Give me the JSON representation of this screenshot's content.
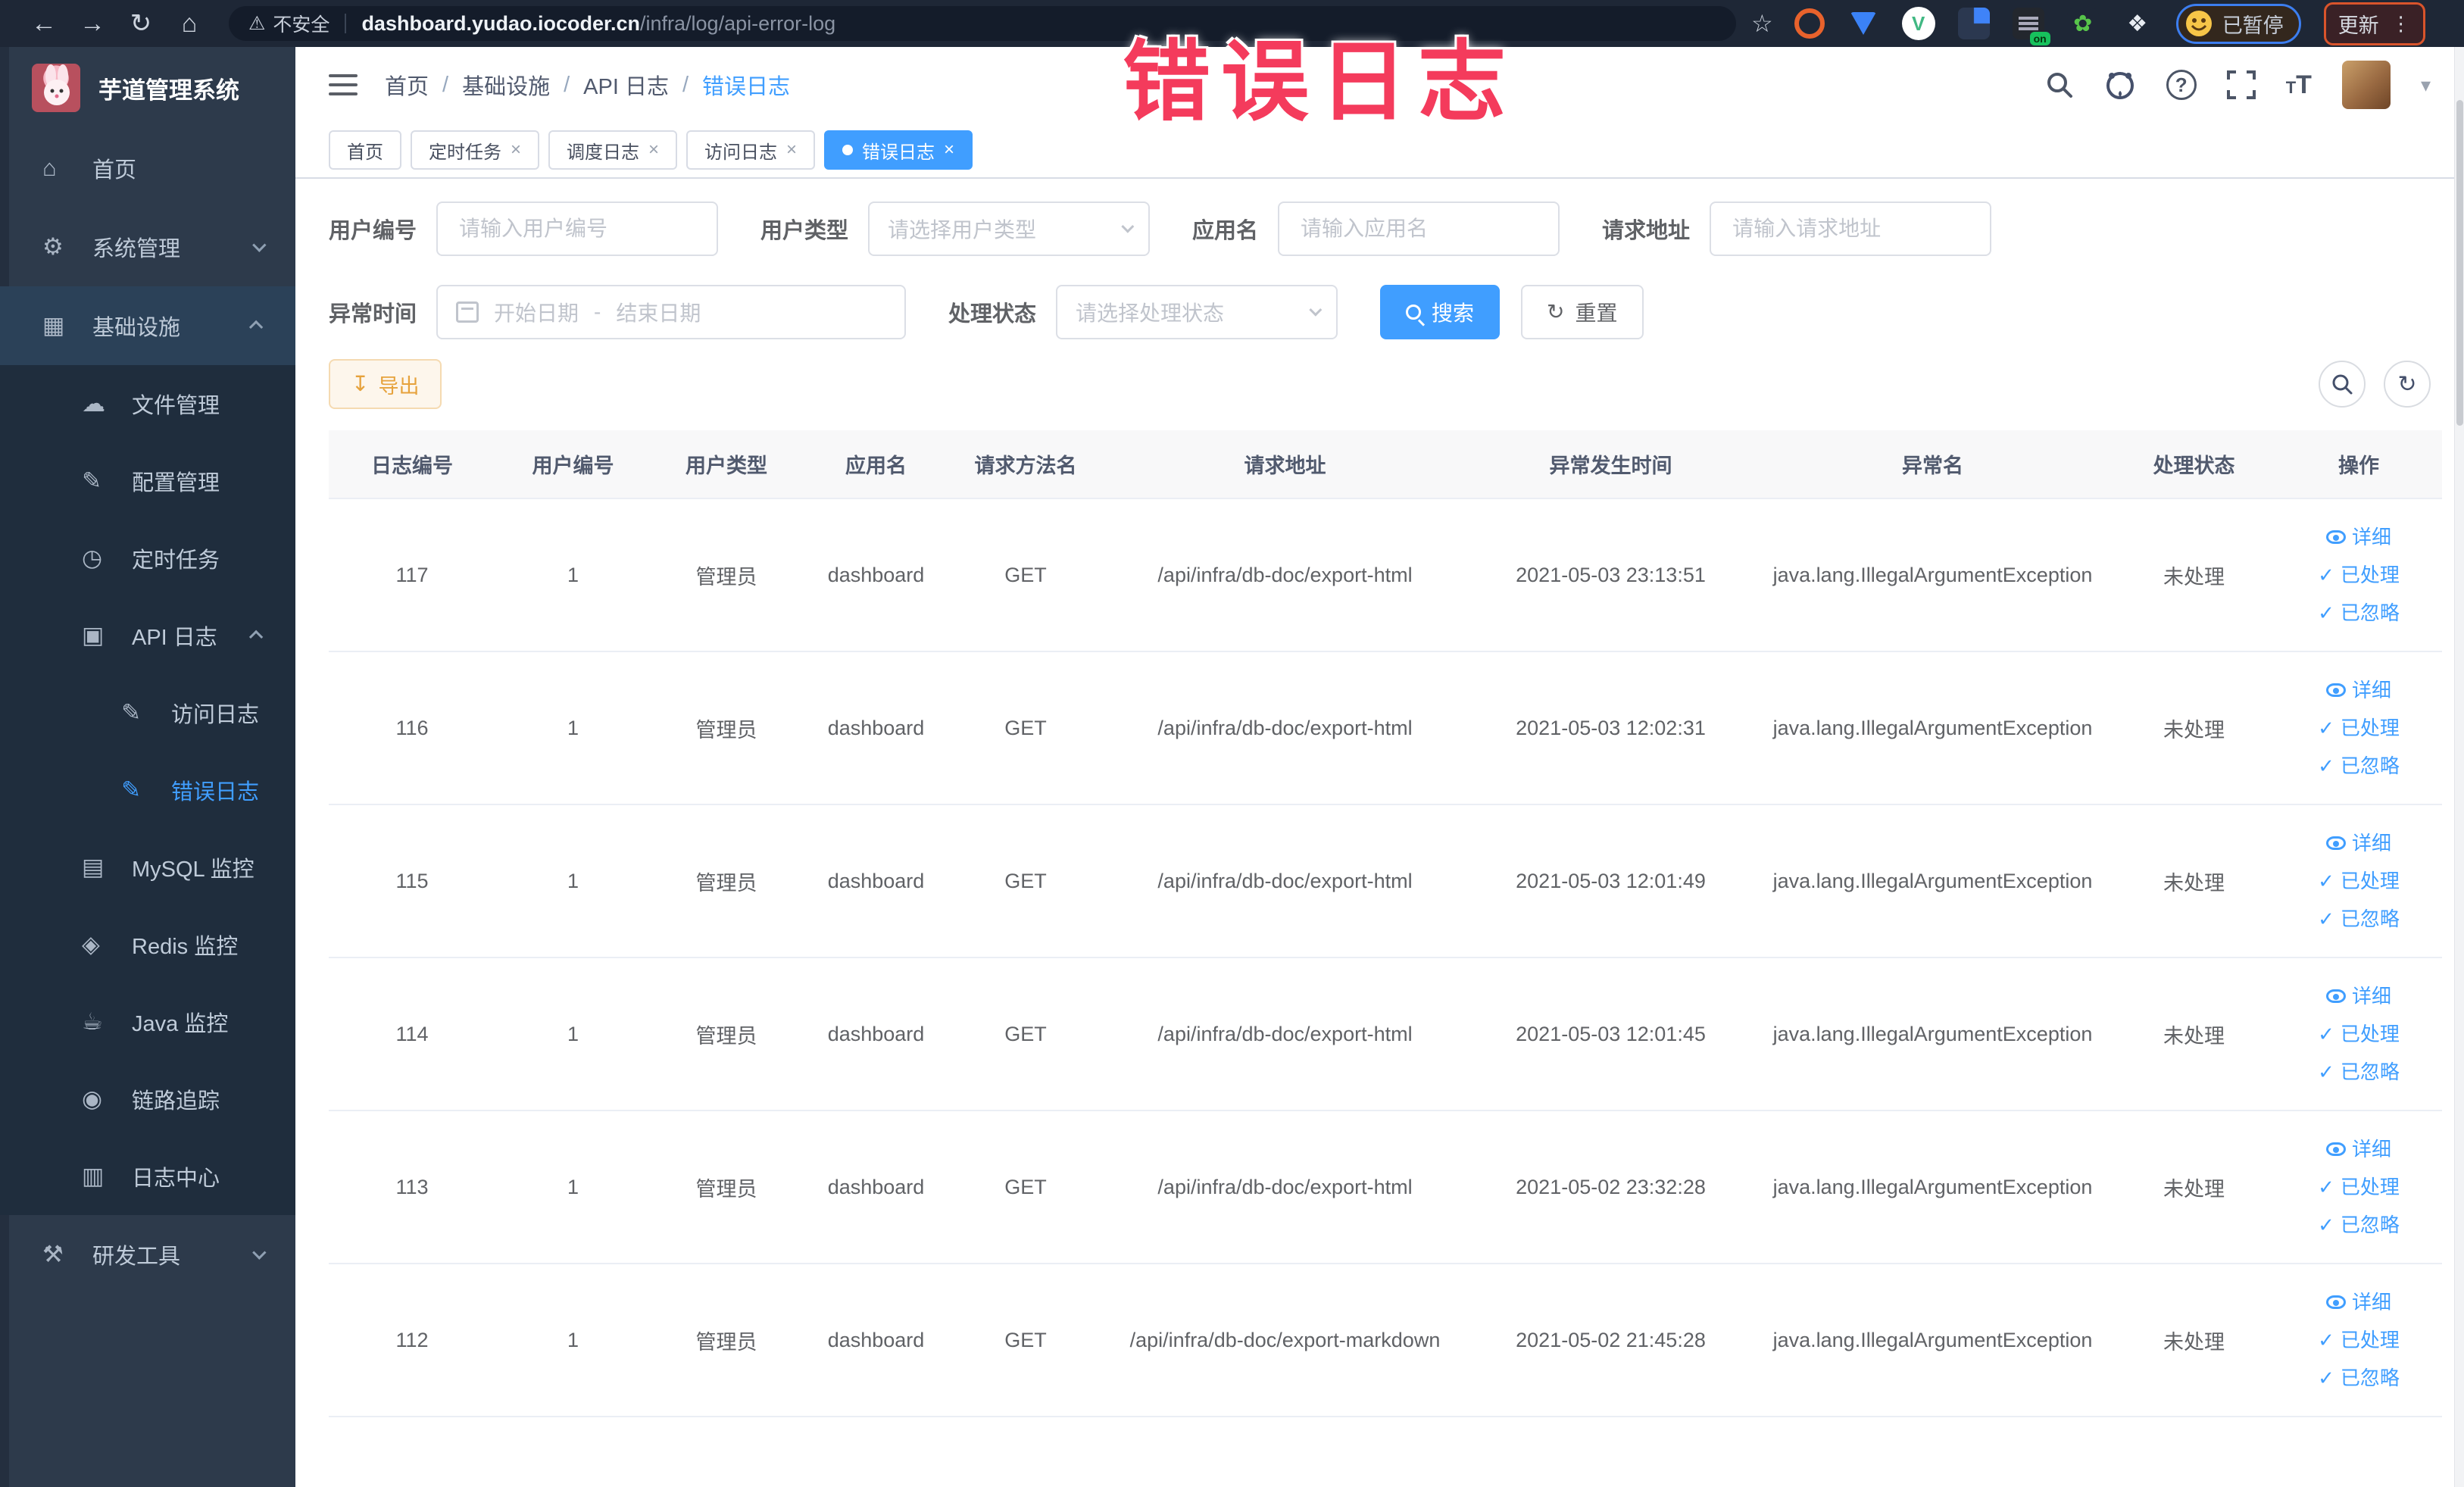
{
  "colors": {
    "primary": "#409eff",
    "warning": "#e6a23c",
    "stamp_pink": "#f43b5c",
    "sidebar_bg": "#2d3a4b",
    "submenu_bg": "#1f2d3d",
    "active_tab_bg": "#409eff"
  },
  "stamp": "错误日志",
  "browser": {
    "security_label": "不安全",
    "url_host": "dashboard.yudao.iocoder.cn",
    "url_path": "/infra/log/api-error-log",
    "paused_label": "已暂停",
    "update_label": "更新"
  },
  "sidebar": {
    "title": "芋道管理系统",
    "items": [
      {
        "label": "首页"
      },
      {
        "label": "系统管理"
      },
      {
        "label": "基础设施"
      },
      {
        "label": "文件管理"
      },
      {
        "label": "配置管理"
      },
      {
        "label": "定时任务"
      },
      {
        "label": "API 日志"
      },
      {
        "label": "访问日志"
      },
      {
        "label": "错误日志"
      },
      {
        "label": "MySQL 监控"
      },
      {
        "label": "Redis 监控"
      },
      {
        "label": "Java 监控"
      },
      {
        "label": "链路追踪"
      },
      {
        "label": "日志中心"
      },
      {
        "label": "研发工具"
      }
    ]
  },
  "header": {
    "breadcrumb": [
      "首页",
      "基础设施",
      "API 日志",
      "错误日志"
    ]
  },
  "tabs": [
    {
      "label": "首页"
    },
    {
      "label": "定时任务"
    },
    {
      "label": "调度日志"
    },
    {
      "label": "访问日志"
    },
    {
      "label": "错误日志"
    }
  ],
  "filters": {
    "user_id": {
      "label": "用户编号",
      "placeholder": "请输入用户编号"
    },
    "user_type": {
      "label": "用户类型",
      "placeholder": "请选择用户类型"
    },
    "app_name": {
      "label": "应用名",
      "placeholder": "请输入应用名"
    },
    "request_url": {
      "label": "请求地址",
      "placeholder": "请输入请求地址"
    },
    "exception_time": {
      "label": "异常时间",
      "start_placeholder": "开始日期",
      "separator": "-",
      "end_placeholder": "结束日期"
    },
    "process_status": {
      "label": "处理状态",
      "placeholder": "请选择处理状态"
    },
    "search_button": "搜索",
    "reset_button": "重置"
  },
  "toolbar": {
    "export_label": "导出"
  },
  "table": {
    "columns": [
      "日志编号",
      "用户编号",
      "用户类型",
      "应用名",
      "请求方法名",
      "请求地址",
      "异常发生时间",
      "异常名",
      "处理状态",
      "操作"
    ],
    "actions": {
      "detail": "详细",
      "processed": "已处理",
      "ignored": "已忽略"
    },
    "rows": [
      {
        "id": "117",
        "user_id": "1",
        "user_type": "管理员",
        "app_name": "dashboard",
        "method": "GET",
        "url": "/api/infra/db-doc/export-html",
        "time": "2021-05-03 23:13:51",
        "exception": "java.lang.IllegalArgumentException",
        "status": "未处理"
      },
      {
        "id": "116",
        "user_id": "1",
        "user_type": "管理员",
        "app_name": "dashboard",
        "method": "GET",
        "url": "/api/infra/db-doc/export-html",
        "time": "2021-05-03 12:02:31",
        "exception": "java.lang.IllegalArgumentException",
        "status": "未处理"
      },
      {
        "id": "115",
        "user_id": "1",
        "user_type": "管理员",
        "app_name": "dashboard",
        "method": "GET",
        "url": "/api/infra/db-doc/export-html",
        "time": "2021-05-03 12:01:49",
        "exception": "java.lang.IllegalArgumentException",
        "status": "未处理"
      },
      {
        "id": "114",
        "user_id": "1",
        "user_type": "管理员",
        "app_name": "dashboard",
        "method": "GET",
        "url": "/api/infra/db-doc/export-html",
        "time": "2021-05-03 12:01:45",
        "exception": "java.lang.IllegalArgumentException",
        "status": "未处理"
      },
      {
        "id": "113",
        "user_id": "1",
        "user_type": "管理员",
        "app_name": "dashboard",
        "method": "GET",
        "url": "/api/infra/db-doc/export-html",
        "time": "2021-05-02 23:32:28",
        "exception": "java.lang.IllegalArgumentException",
        "status": "未处理"
      },
      {
        "id": "112",
        "user_id": "1",
        "user_type": "管理员",
        "app_name": "dashboard",
        "method": "GET",
        "url": "/api/infra/db-doc/export-markdown",
        "time": "2021-05-02 21:45:28",
        "exception": "java.lang.IllegalArgumentException",
        "status": "未处理"
      }
    ]
  }
}
